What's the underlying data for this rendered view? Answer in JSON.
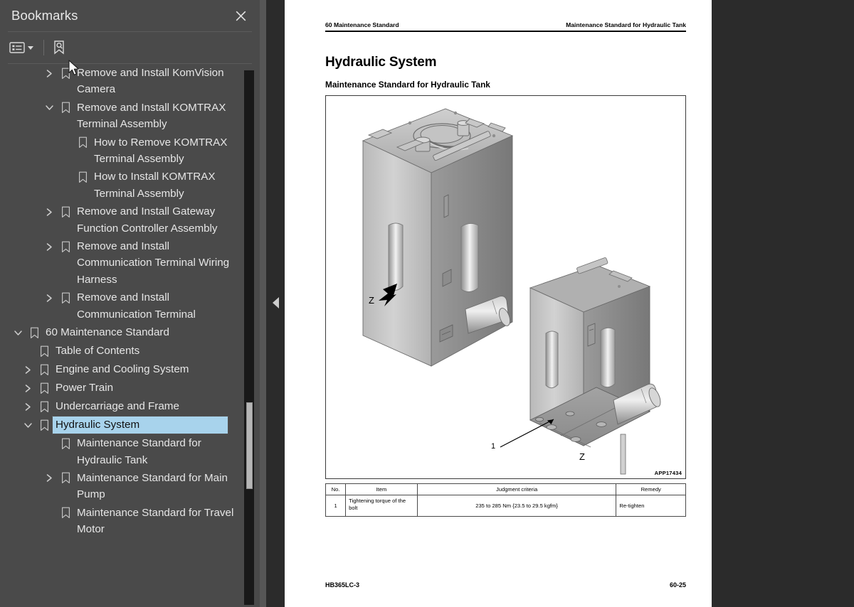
{
  "sidebar": {
    "title": "Bookmarks",
    "close_icon": "close-icon",
    "toolbar": {
      "options_icon": "list-options-icon",
      "caret_icon": "chevron-down-icon",
      "find_bookmark_icon": "bookmark-search-icon"
    },
    "tree": [
      {
        "label": "Remove and Install KomVision Camera",
        "indent": 2,
        "twisty": "collapsed",
        "selected": false
      },
      {
        "label": "Remove and Install KOMTRAX Terminal Assembly",
        "indent": 2,
        "twisty": "expanded",
        "selected": false
      },
      {
        "label": "How to Remove KOMTRAX Terminal Assembly",
        "indent": 3,
        "twisty": "none",
        "selected": false
      },
      {
        "label": "How to Install KOMTRAX Terminal Assembly",
        "indent": 3,
        "twisty": "none",
        "selected": false
      },
      {
        "label": "Remove and Install Gateway Function Controller Assembly",
        "indent": 2,
        "twisty": "collapsed",
        "selected": false
      },
      {
        "label": "Remove and Install Communication Terminal Wiring Harness",
        "indent": 2,
        "twisty": "collapsed",
        "selected": false
      },
      {
        "label": "Remove and Install Communication Terminal",
        "indent": 2,
        "twisty": "collapsed",
        "selected": false
      },
      {
        "label": "60 Maintenance Standard",
        "indent": 0,
        "twisty": "expanded",
        "selected": false
      },
      {
        "label": "Table of Contents",
        "indent": 1,
        "twisty": "none",
        "selected": false
      },
      {
        "label": "Engine and Cooling System",
        "indent": 1,
        "twisty": "collapsed",
        "selected": false
      },
      {
        "label": "Power Train",
        "indent": 1,
        "twisty": "collapsed",
        "selected": false
      },
      {
        "label": "Undercarriage and Frame",
        "indent": 1,
        "twisty": "collapsed",
        "selected": false
      },
      {
        "label": "Hydraulic System",
        "indent": 1,
        "twisty": "expanded",
        "selected": true
      },
      {
        "label": "Maintenance Standard for Hydraulic Tank",
        "indent": 2,
        "twisty": "none",
        "selected": false
      },
      {
        "label": "Maintenance Standard for Main Pump",
        "indent": 2,
        "twisty": "collapsed",
        "selected": false
      },
      {
        "label": "Maintenance Standard for Travel Motor",
        "indent": 2,
        "twisty": "none",
        "selected": false
      }
    ],
    "selection_color": "#a8d3ec"
  },
  "splitter": {
    "collapse_icon": "collapse-left-triangle-icon"
  },
  "document": {
    "header_left": "60 Maintenance Standard",
    "header_right": "Maintenance Standard for Hydraulic Tank",
    "heading": "Hydraulic System",
    "subheading": "Maintenance Standard for Hydraulic Tank",
    "figure": {
      "drawing_id": "APP17434",
      "view_label_top": "Z",
      "view_label_bottom": "Z",
      "callout": "1",
      "arrow_icon": "view-direction-arrow-icon"
    },
    "table": {
      "columns": [
        "No.",
        "Item",
        "Judgment criteria",
        "Remedy"
      ],
      "rows": [
        {
          "no": "1",
          "item": "Tightening torque of the bolt",
          "judgment": "235 to 285 Nm {23.5 to 29.5 kgfm}",
          "remedy": "Re-tighten"
        }
      ]
    },
    "footer_left": "HB365LC-3",
    "footer_right": "60-25"
  },
  "cursor": {
    "icon": "mouse-pointer-arrow"
  }
}
